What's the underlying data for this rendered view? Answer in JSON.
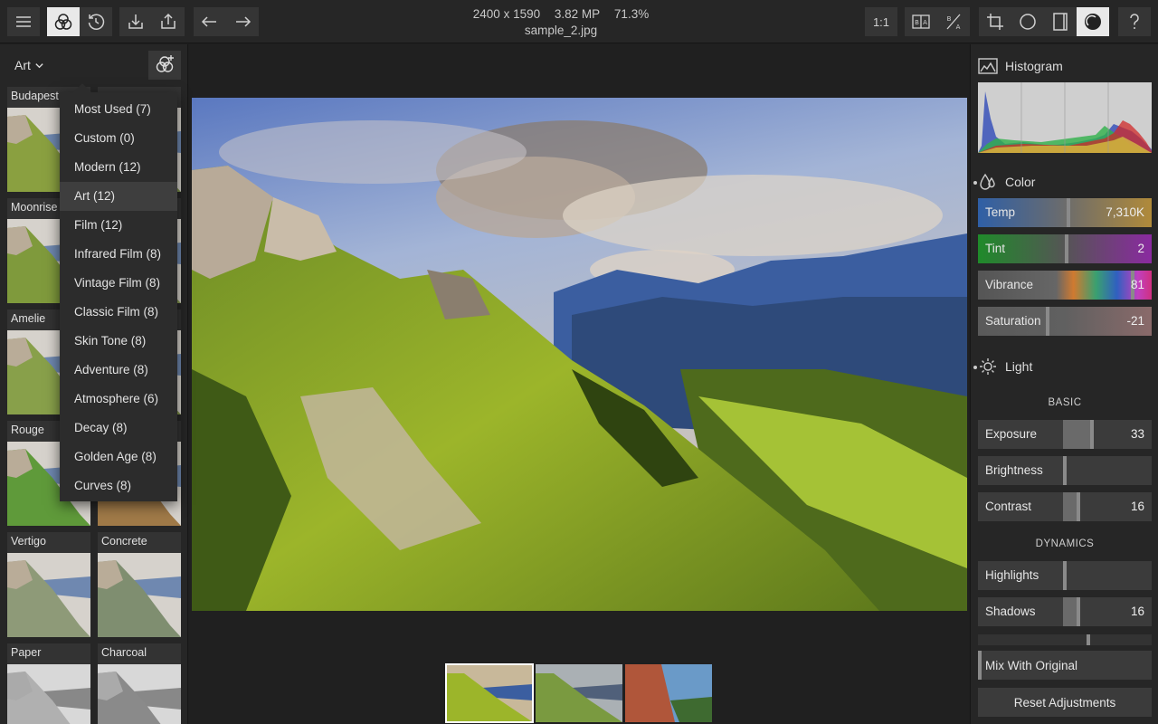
{
  "image_info": {
    "dimensions": "2400 x 1590",
    "megapixels": "3.82 MP",
    "zoom": "71.3%",
    "filename": "sample_2.jpg"
  },
  "toolbar": {
    "ratio_label": "1:1"
  },
  "left_panel": {
    "category_label": "Art",
    "filters": [
      {
        "name": "Budapest"
      },
      {
        "name": ""
      },
      {
        "name": "Moonrise"
      },
      {
        "name": ""
      },
      {
        "name": "Amelie"
      },
      {
        "name": ""
      },
      {
        "name": "Rouge"
      },
      {
        "name": ""
      },
      {
        "name": "Vertigo"
      },
      {
        "name": "Concrete"
      },
      {
        "name": "Paper"
      },
      {
        "name": "Charcoal"
      }
    ],
    "menu": [
      {
        "label": "Most Used (7)"
      },
      {
        "label": "Custom (0)"
      },
      {
        "label": "Modern (12)"
      },
      {
        "label": "Art (12)"
      },
      {
        "label": "Film (12)"
      },
      {
        "label": "Infrared Film (8)"
      },
      {
        "label": "Vintage Film (8)"
      },
      {
        "label": "Classic Film (8)"
      },
      {
        "label": "Skin Tone (8)"
      },
      {
        "label": "Adventure (8)"
      },
      {
        "label": "Atmosphere (6)"
      },
      {
        "label": "Decay (8)"
      },
      {
        "label": "Golden Age (8)"
      },
      {
        "label": "Curves (8)"
      }
    ],
    "menu_selected": "Art (12)"
  },
  "right_panel": {
    "histogram_title": "Histogram",
    "color_title": "Color",
    "light_title": "Light",
    "basic_label": "BASIC",
    "dynamics_label": "DYNAMICS",
    "color_sliders": [
      {
        "label": "Temp",
        "value": "7,310K",
        "level": 0.52
      },
      {
        "label": "Tint",
        "value": "2",
        "level": 0.51
      },
      {
        "label": "Vibrance",
        "value": "81",
        "level": 0.9
      },
      {
        "label": "Saturation",
        "value": "-21",
        "level": 0.4
      }
    ],
    "basic_sliders": [
      {
        "label": "Exposure",
        "value": "33",
        "level": 0.66
      },
      {
        "label": "Brightness",
        "value": "",
        "level": 0.5
      },
      {
        "label": "Contrast",
        "value": "16",
        "level": 0.58
      }
    ],
    "dynamics_sliders": [
      {
        "label": "Highlights",
        "value": "",
        "level": 0.5
      },
      {
        "label": "Shadows",
        "value": "16",
        "level": 0.58
      }
    ],
    "mix_label": "Mix With Original",
    "reset_label": "Reset Adjustments"
  },
  "colors": {
    "accent_selected": "#e9e9e9",
    "panel": "#262626",
    "slider": "#3b3b3b"
  }
}
